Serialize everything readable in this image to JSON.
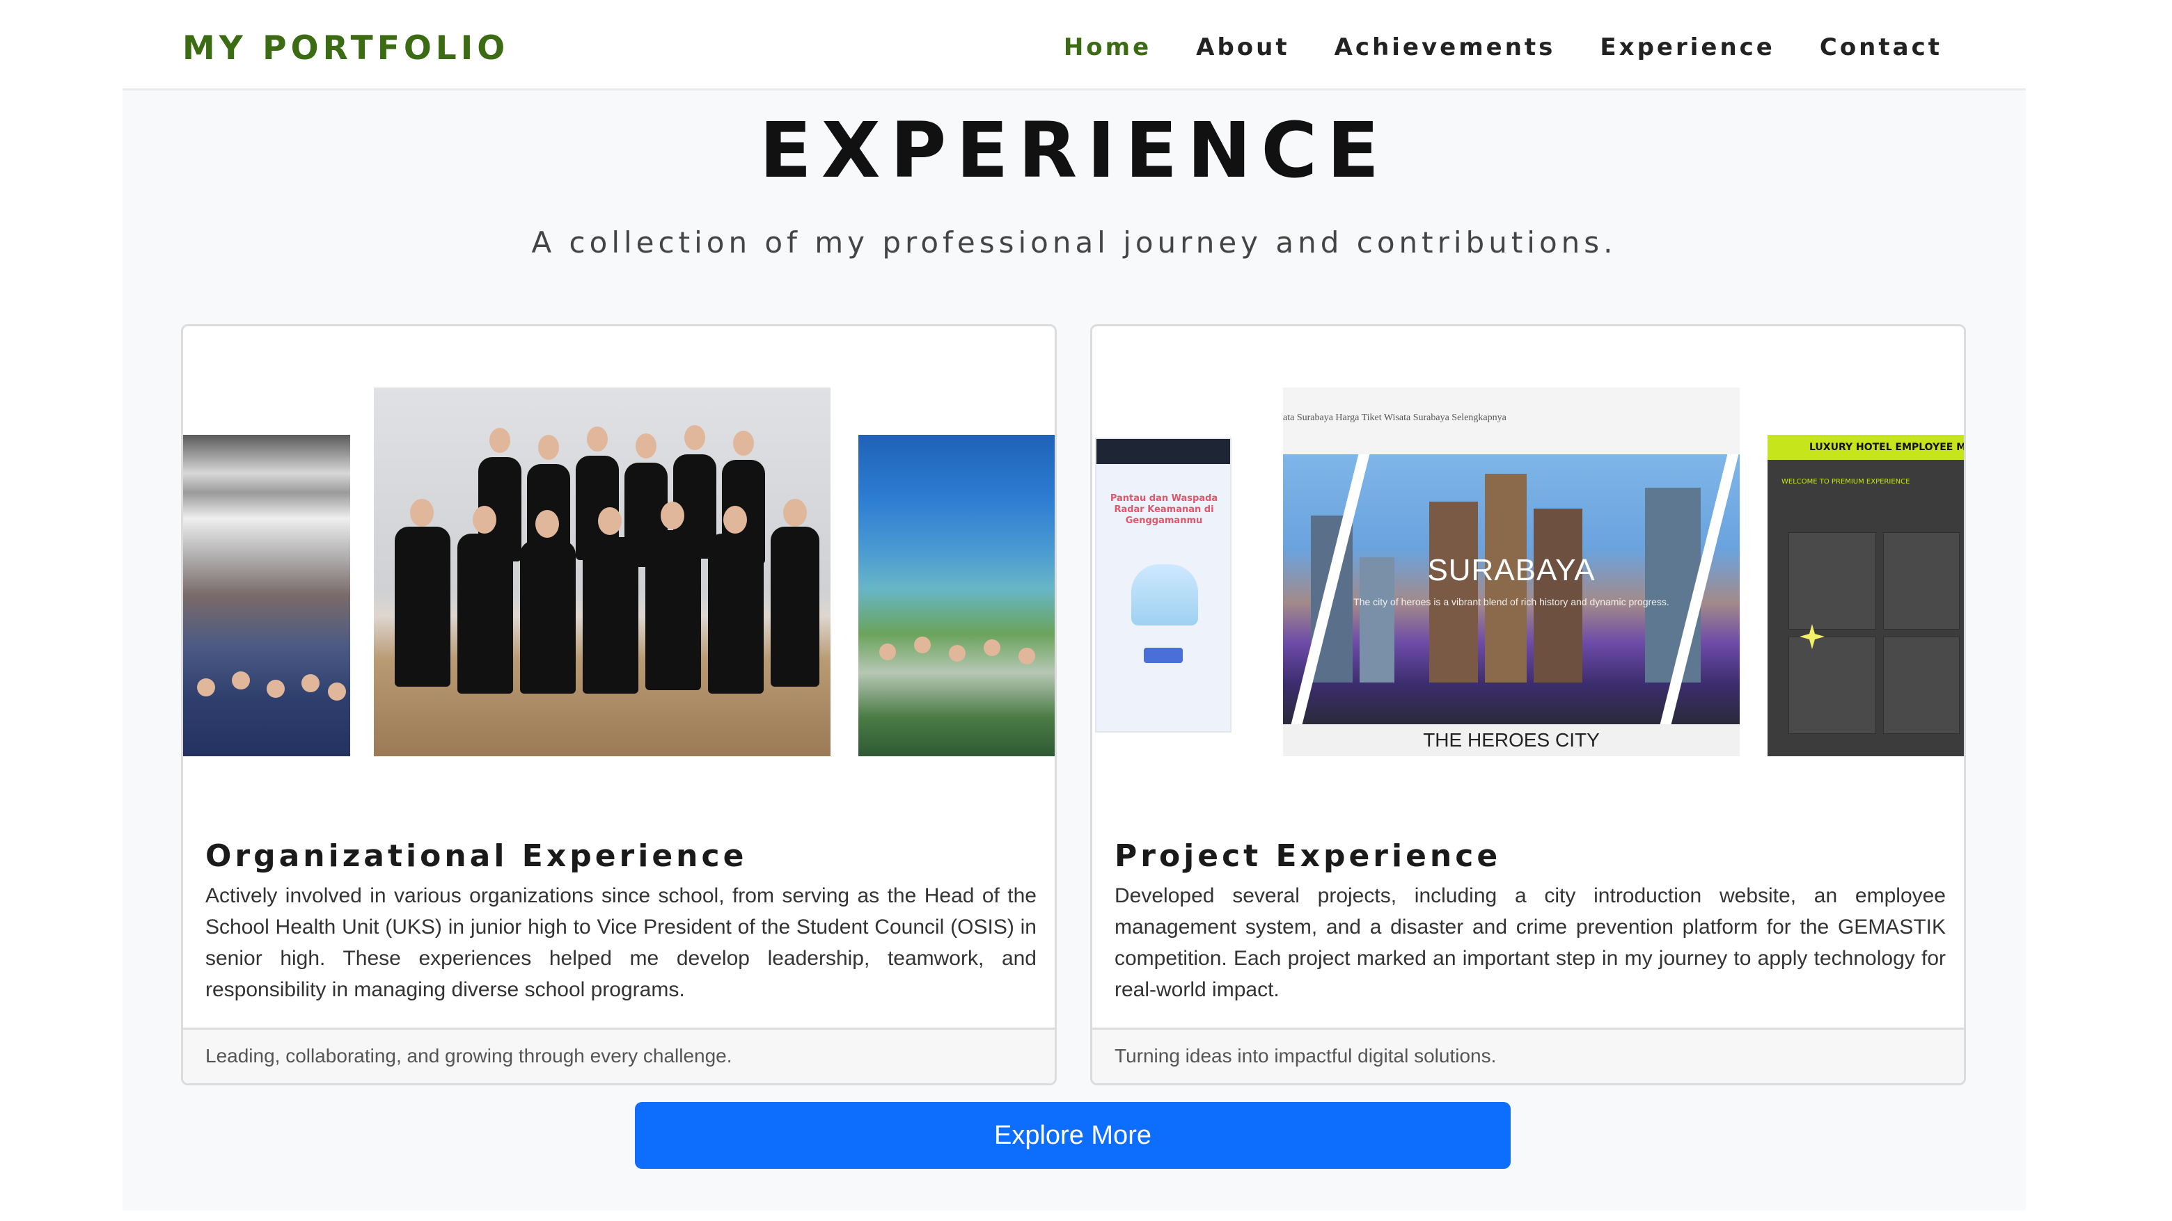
{
  "navbar": {
    "brand": "MY PORTFOLIO",
    "links": [
      "Home",
      "About",
      "Achievements",
      "Experience",
      "Contact"
    ],
    "active": "Home",
    "accent_color": "#3b6b12"
  },
  "section": {
    "title": "EXPERIENCE",
    "subtitle": "A collection of my professional journey and contributions."
  },
  "cards": [
    {
      "title": "Organizational Experience",
      "text": "Actively involved in various organizations since school, from serving as the Head of the School Health Unit (UKS) in junior high to Vice President of the Student Council (OSIS) in senior high. These experiences helped me develop leadership, teamwork, and responsibility in managing diverse school programs.",
      "footer": "Leading, collaborating, and growing through every challenge."
    },
    {
      "title": "Project Experience",
      "text": "Developed several projects, including a city introduction website, an employee management system, and a disaster and crime prevention platform for the GEMASTIK competition. Each project marked an important step in my journey to apply technology for real-world impact.",
      "footer": "Turning ideas into impactful digital solutions.",
      "screens": {
        "mobile_text": "Pantau dan Waspada Radar Keamanan di Genggamanmu",
        "city_nav": "ata Surabaya   Harga Tiket Wisata Surabaya   Selengkapnya",
        "city_name": "SURABAYA",
        "city_tagline": "The city of heroes is a vibrant blend of rich history and dynamic progress.",
        "city_footer": "THE HEROES CITY",
        "hotel_bar": "LUXURY HOTEL EMPLOYEE M",
        "hotel_welcome": "WELCOME TO PREMIUM EXPERIENCE"
      }
    }
  ],
  "cta": {
    "label": "Explore More",
    "color": "#0d6efd"
  }
}
